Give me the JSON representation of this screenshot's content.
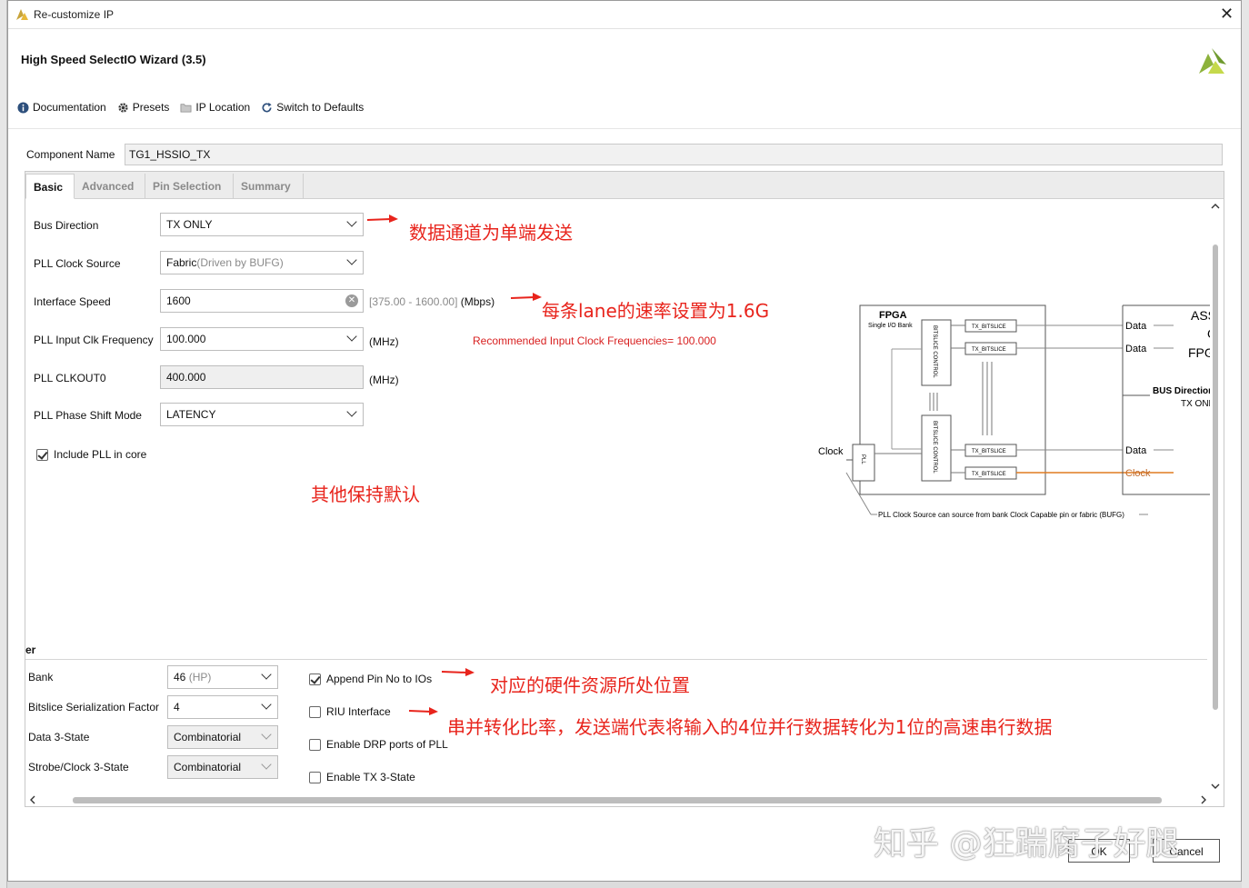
{
  "window": {
    "title": "Re-customize IP",
    "close_glyph": "✕"
  },
  "wizard": {
    "name": "High Speed SelectIO Wizard (3.5)"
  },
  "toolbar": [
    {
      "label": "Documentation",
      "icon": "info-icon"
    },
    {
      "label": "Presets",
      "icon": "gear-icon"
    },
    {
      "label": "IP Location",
      "icon": "folder-icon"
    },
    {
      "label": "Switch to Defaults",
      "icon": "refresh-icon"
    }
  ],
  "component": {
    "label": "Component Name",
    "value": "TG1_HSSIO_TX"
  },
  "tabs": [
    "Basic",
    "Advanced",
    "Pin Selection",
    "Summary"
  ],
  "basic": {
    "bus_direction": {
      "label": "Bus Direction",
      "value": "TX ONLY"
    },
    "pll_clock_source": {
      "label": "PLL Clock Source",
      "value": "Fabric",
      "hint": "(Driven by BUFG)"
    },
    "interface_speed": {
      "label": "Interface Speed",
      "value": "1600",
      "range": "[375.00 - 1600.00]",
      "unit": "(Mbps)"
    },
    "pll_input_clk": {
      "label": "PLL Input Clk Frequency",
      "value": "100.000",
      "unit": "(MHz)"
    },
    "pll_clkout0": {
      "label": "PLL CLKOUT0",
      "value": "400.000",
      "unit": "(MHz)"
    },
    "pll_phase_shift": {
      "label": "PLL Phase Shift Mode",
      "value": "LATENCY"
    },
    "include_pll": {
      "label": "Include PLL in core",
      "checked": true
    },
    "recommended": "Recommended Input Clock Frequencies= 100.000"
  },
  "lower": {
    "section_fragment": "er",
    "bank": {
      "label": "Bank",
      "value": "46",
      "hint": "(HP)"
    },
    "serialization": {
      "label": "Bitslice Serialization Factor",
      "value": "4"
    },
    "data_3state": {
      "label": "Data 3-State",
      "value": "Combinatorial"
    },
    "strobe_3state": {
      "label": "Strobe/Clock 3-State",
      "value": "Combinatorial"
    },
    "append_pin": {
      "label": "Append Pin No to IOs",
      "checked": true
    },
    "riu": {
      "label": "RIU Interface",
      "checked": false
    },
    "drp": {
      "label": "Enable DRP ports of PLL",
      "checked": false
    },
    "tx3state": {
      "label": "Enable TX 3-State",
      "checked": false
    }
  },
  "annotations": {
    "a1": "数据通道为单端发送",
    "a2": "每条lane的速率设置为1.6G",
    "a3": "其他保持默认",
    "a4": "对应的硬件资源所处位置",
    "a5": "串并转化比率，发送端代表将输入的4位并行数据转化为1位的高速串行数据"
  },
  "diagram": {
    "fpga": "FPGA",
    "bank": "Single I/O Bank",
    "bitslice_control": "BITSLICE CONTROL",
    "tx_bitslice": "TX_BITSLICE",
    "pll": "PLL",
    "clock_in": "Clock",
    "assp": "ASSP",
    "or": "Or",
    "fpga2": "FPGA",
    "data": "Data",
    "clock_out": "Clock",
    "bus_dir_label": "BUS Direction:",
    "bus_dir_value": "TX ONLY",
    "note": "PLL Clock Source can source from bank Clock Capable pin or fabric (BUFG)"
  },
  "buttons": {
    "ok": "OK",
    "cancel": "Cancel"
  },
  "watermark": "知乎 @狂踹腐子好腿",
  "colors": {
    "annotation": "#e8241c",
    "clock_line": "#e07b20",
    "brand": "#8db23c"
  }
}
